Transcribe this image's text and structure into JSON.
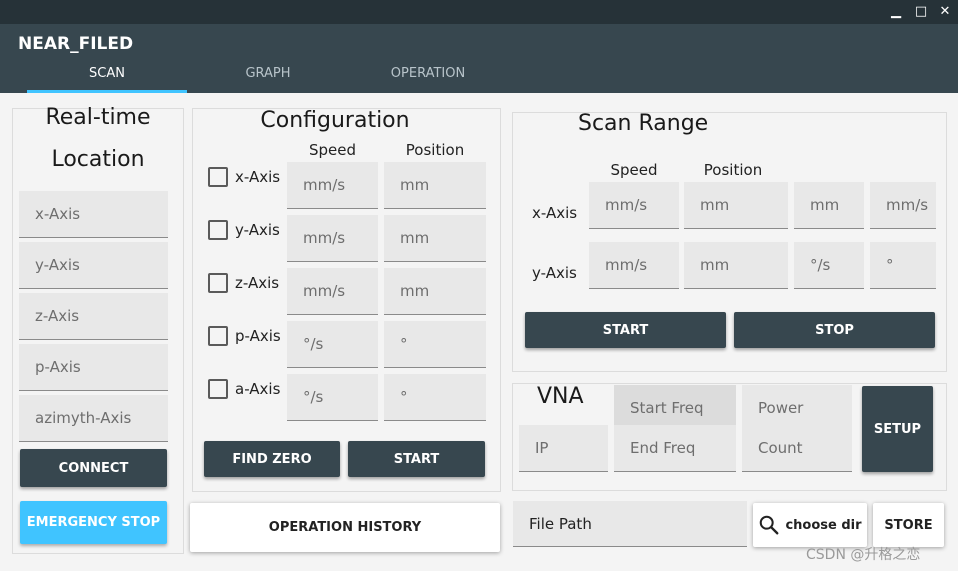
{
  "app": {
    "title": "NEAR_FILED",
    "window_controls": {
      "minimize": "▁",
      "maximize": "□",
      "close": "✕"
    }
  },
  "tabs": [
    {
      "label": "SCAN",
      "active": true
    },
    {
      "label": "GRAPH",
      "active": false
    },
    {
      "label": "OPERATION",
      "active": false
    }
  ],
  "realtime": {
    "title_line1": "Real-time",
    "title_line2": "Location",
    "fields": [
      {
        "placeholder": "x-Axis"
      },
      {
        "placeholder": "y-Axis"
      },
      {
        "placeholder": "z-Axis"
      },
      {
        "placeholder": "p-Axis"
      },
      {
        "placeholder": "azimyth-Axis"
      }
    ],
    "connect_label": "CONNECT",
    "emergency_label": "EMERGENCY STOP"
  },
  "config": {
    "title": "Configuration",
    "col_speed": "Speed",
    "col_position": "Position",
    "rows": [
      {
        "axis": "x-Axis",
        "speed_ph": "mm/s",
        "pos_ph": "mm",
        "checked": false
      },
      {
        "axis": "y-Axis",
        "speed_ph": "mm/s",
        "pos_ph": "mm",
        "checked": false
      },
      {
        "axis": "z-Axis",
        "speed_ph": "mm/s",
        "pos_ph": "mm",
        "checked": false
      },
      {
        "axis": "p-Axis",
        "speed_ph": "°/s",
        "pos_ph": "°",
        "checked": false
      },
      {
        "axis": "a-Axis",
        "speed_ph": "°/s",
        "pos_ph": "°",
        "checked": false
      }
    ],
    "find_zero_label": "FIND ZERO",
    "start_label": "START"
  },
  "operation_history_label": "OPERATION HISTORY",
  "scan_range": {
    "title": "Scan Range",
    "col_speed": "Speed",
    "col_position": "Position",
    "rows": [
      {
        "axis": "x-Axis",
        "speed_ph": "mm/s",
        "pos_ph": "mm",
        "f3": "mm",
        "f4": "mm/s"
      },
      {
        "axis": "y-Axis",
        "speed_ph": "mm/s",
        "pos_ph": "mm",
        "f3": "°/s",
        "f4": "°"
      }
    ],
    "start_label": "START",
    "stop_label": "STOP"
  },
  "vna": {
    "title": "VNA",
    "ip_ph": "IP",
    "start_freq_ph": "Start Freq",
    "end_freq_ph": "End Freq",
    "power_ph": "Power",
    "count_ph": "Count",
    "setup_label": "SETUP"
  },
  "file": {
    "path_label": "File Path",
    "choose_dir_label": "choose dir",
    "store_label": "STORE"
  },
  "watermark": "CSDN @升格之恋",
  "colors": {
    "header_bg": "#37474f",
    "titlebar_bg": "#263238",
    "accent": "#40c4ff",
    "button_dark": "#37474f"
  }
}
